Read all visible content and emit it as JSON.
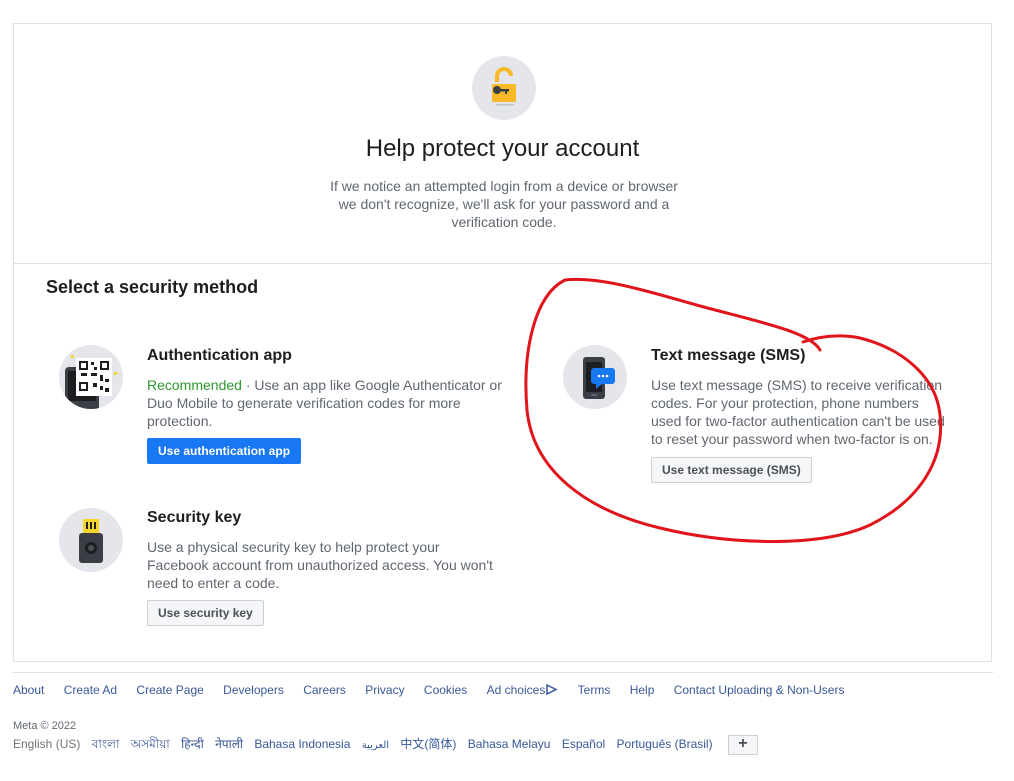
{
  "hero": {
    "title": "Help protect your account",
    "description": "If we notice an attempted login from a device or browser we don't recognize, we'll ask for your password and a verification code."
  },
  "section_title": "Select a security method",
  "methods": {
    "auth_app": {
      "title": "Authentication app",
      "recommended": "Recommended",
      "description": " · Use an app like Google Authenticator or Duo Mobile to generate verification codes for more protection.",
      "button": "Use authentication app",
      "icon": "qr-code-icon"
    },
    "sms": {
      "title": "Text message (SMS)",
      "description": "Use text message (SMS) to receive verification codes. For your protection, phone numbers used for two-factor authentication can't be used to reset your password when two-factor is on.",
      "button": "Use text message (SMS)",
      "icon": "phone-chat-icon"
    },
    "security_key": {
      "title": "Security key",
      "description": "Use a physical security key to help protect your Facebook account from unauthorized access. You won't need to enter a code.",
      "button": "Use security key",
      "icon": "usb-key-icon"
    }
  },
  "footer": {
    "links": [
      "About",
      "Create Ad",
      "Create Page",
      "Developers",
      "Careers",
      "Privacy",
      "Cookies",
      "Ad choices",
      "Terms",
      "Help",
      "Contact Uploading & Non-Users"
    ],
    "copyright": "Meta © 2022",
    "current_language": "English (US)",
    "languages": [
      "বাংলা",
      "অসমীয়া",
      "हिन्दी",
      "नेपाली",
      "Bahasa Indonesia",
      "العربية",
      "中文(简体)",
      "Bahasa Melayu",
      "Español",
      "Português (Brasil)"
    ],
    "more_languages": "+"
  },
  "colors": {
    "primary": "#1877f2",
    "recommended": "#2d9a2d",
    "annotation": "#e0141a",
    "lock": "#f7b928"
  }
}
